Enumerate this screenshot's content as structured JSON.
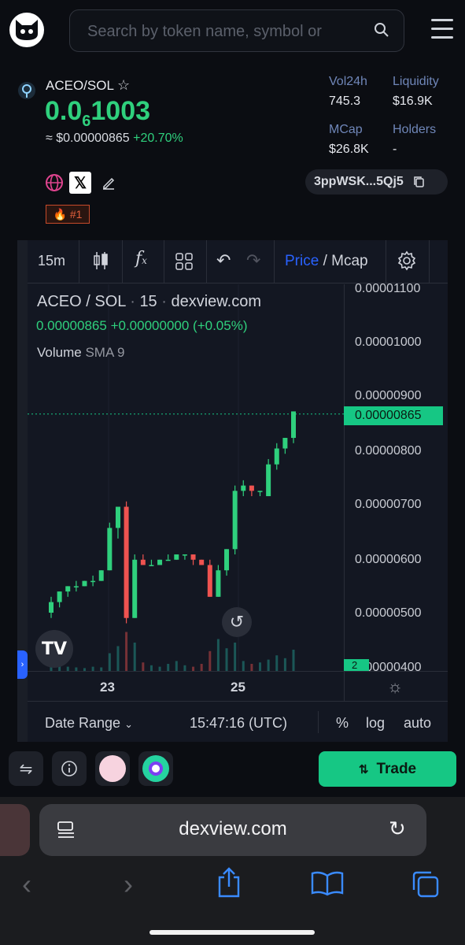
{
  "header": {
    "search_placeholder": "Search by token name, symbol or"
  },
  "token": {
    "pair": "ACEO/SOL",
    "price_prefix": "0.0",
    "price_sub": "6",
    "price_rest": "1003",
    "usd_price": "≈ $0.00000865",
    "change": "+20.70%",
    "rank": "#1",
    "address": "3ppWSK...5Qj5"
  },
  "stats": [
    {
      "label": "Vol24h",
      "value": "745.3"
    },
    {
      "label": "Liquidity",
      "value": "$16.9K"
    },
    {
      "label": "MCap",
      "value": "$26.8K"
    },
    {
      "label": "Holders",
      "value": "-"
    }
  ],
  "chart_toolbar": {
    "interval": "15m",
    "price_label": "Price",
    "sep": "/",
    "mcap_label": "Mcap"
  },
  "chart_legend": {
    "pair": "ACEO / SOL",
    "dot": "·",
    "interval": "15",
    "source": "dexview.com",
    "ohlc": "0.00000865",
    "change": "+0.00000000 (+0.05%)",
    "volume": "Volume",
    "sma": "SMA 9"
  },
  "chart_data": {
    "type": "candlestick",
    "price_ticks": [
      "0.00001100",
      "0.00001000",
      "0.00000900",
      "0.00000800",
      "0.00000700",
      "0.00000600",
      "0.00000500",
      "0.00000400"
    ],
    "current_price": "0.00000865",
    "time_ticks": [
      "23",
      "25"
    ],
    "volume_badge": "2",
    "ylim": [
      3.8e-06,
      1.11e-05
    ],
    "candles": [
      [
        4.9e-06,
        5.2e-06,
        5.1e-06,
        4.8e-06
      ],
      [
        5.1e-06,
        5.3e-06,
        5.3e-06,
        5e-06
      ],
      [
        5.3e-06,
        5.4e-06,
        5.4e-06,
        5.2e-06
      ],
      [
        5.4e-06,
        5.5e-06,
        5.4e-06,
        5.3e-06
      ],
      [
        5.4e-06,
        5.5e-06,
        5.5e-06,
        5.4e-06
      ],
      [
        5.5e-06,
        5.6e-06,
        5.5e-06,
        5.4e-06
      ],
      [
        5.5e-06,
        5.7e-06,
        5.7e-06,
        5.5e-06
      ],
      [
        5.7e-06,
        6.6e-06,
        6.5e-06,
        5.7e-06
      ],
      [
        6.5e-06,
        6.9e-06,
        6.9e-06,
        6.3e-06
      ],
      [
        6.9e-06,
        7e-06,
        4.8e-06,
        4.7e-06
      ],
      [
        4.8e-06,
        6e-06,
        5.9e-06,
        4.8e-06
      ],
      [
        5.9e-06,
        6e-06,
        5.8e-06,
        5.8e-06
      ],
      [
        5.8e-06,
        5.9e-06,
        5.8e-06,
        5.8e-06
      ],
      [
        5.8e-06,
        5.9e-06,
        5.9e-06,
        5.8e-06
      ],
      [
        5.9e-06,
        6e-06,
        5.9e-06,
        5.9e-06
      ],
      [
        5.9e-06,
        6e-06,
        6e-06,
        5.9e-06
      ],
      [
        6e-06,
        6e-06,
        6e-06,
        5.9e-06
      ],
      [
        6e-06,
        6e-06,
        5.9e-06,
        5.8e-06
      ],
      [
        5.9e-06,
        5.9e-06,
        5.8e-06,
        5.8e-06
      ],
      [
        5.8e-06,
        5.9e-06,
        5.2e-06,
        5.2e-06
      ],
      [
        5.2e-06,
        5.8e-06,
        5.7e-06,
        5.2e-06
      ],
      [
        5.7e-06,
        6.1e-06,
        6.1e-06,
        5.6e-06
      ],
      [
        6.1e-06,
        7.3e-06,
        7.2e-06,
        6e-06
      ],
      [
        7.2e-06,
        7.4e-06,
        7.3e-06,
        7.1e-06
      ],
      [
        7.3e-06,
        7.3e-06,
        7.2e-06,
        7.1e-06
      ],
      [
        7.2e-06,
        7.2e-06,
        7.2e-06,
        7.1e-06
      ],
      [
        7.1e-06,
        7.8e-06,
        7.7e-06,
        7.1e-06
      ],
      [
        7.7e-06,
        8.1e-06,
        8e-06,
        7.6e-06
      ],
      [
        8e-06,
        8.2e-06,
        8.2e-06,
        7.9e-06
      ],
      [
        8.2e-06,
        8.7e-06,
        8.7e-06,
        8.1e-06
      ]
    ],
    "volumes": [
      10,
      8,
      6,
      5,
      4,
      6,
      5,
      25,
      35,
      55,
      40,
      12,
      8,
      6,
      10,
      14,
      8,
      6,
      10,
      28,
      45,
      32,
      40,
      14,
      10,
      12,
      16,
      22,
      18,
      30
    ]
  },
  "chart_footer": {
    "date_range": "Date Range",
    "time": "15:47:16 (UTC)",
    "pct": "%",
    "log": "log",
    "auto": "auto"
  },
  "actions": {
    "trade": "Trade"
  },
  "browser": {
    "url": "dexview.com"
  },
  "colors": {
    "up": "#26a69a",
    "green": "#2fd07d",
    "down": "#ef5350",
    "accent": "#2962ff"
  }
}
